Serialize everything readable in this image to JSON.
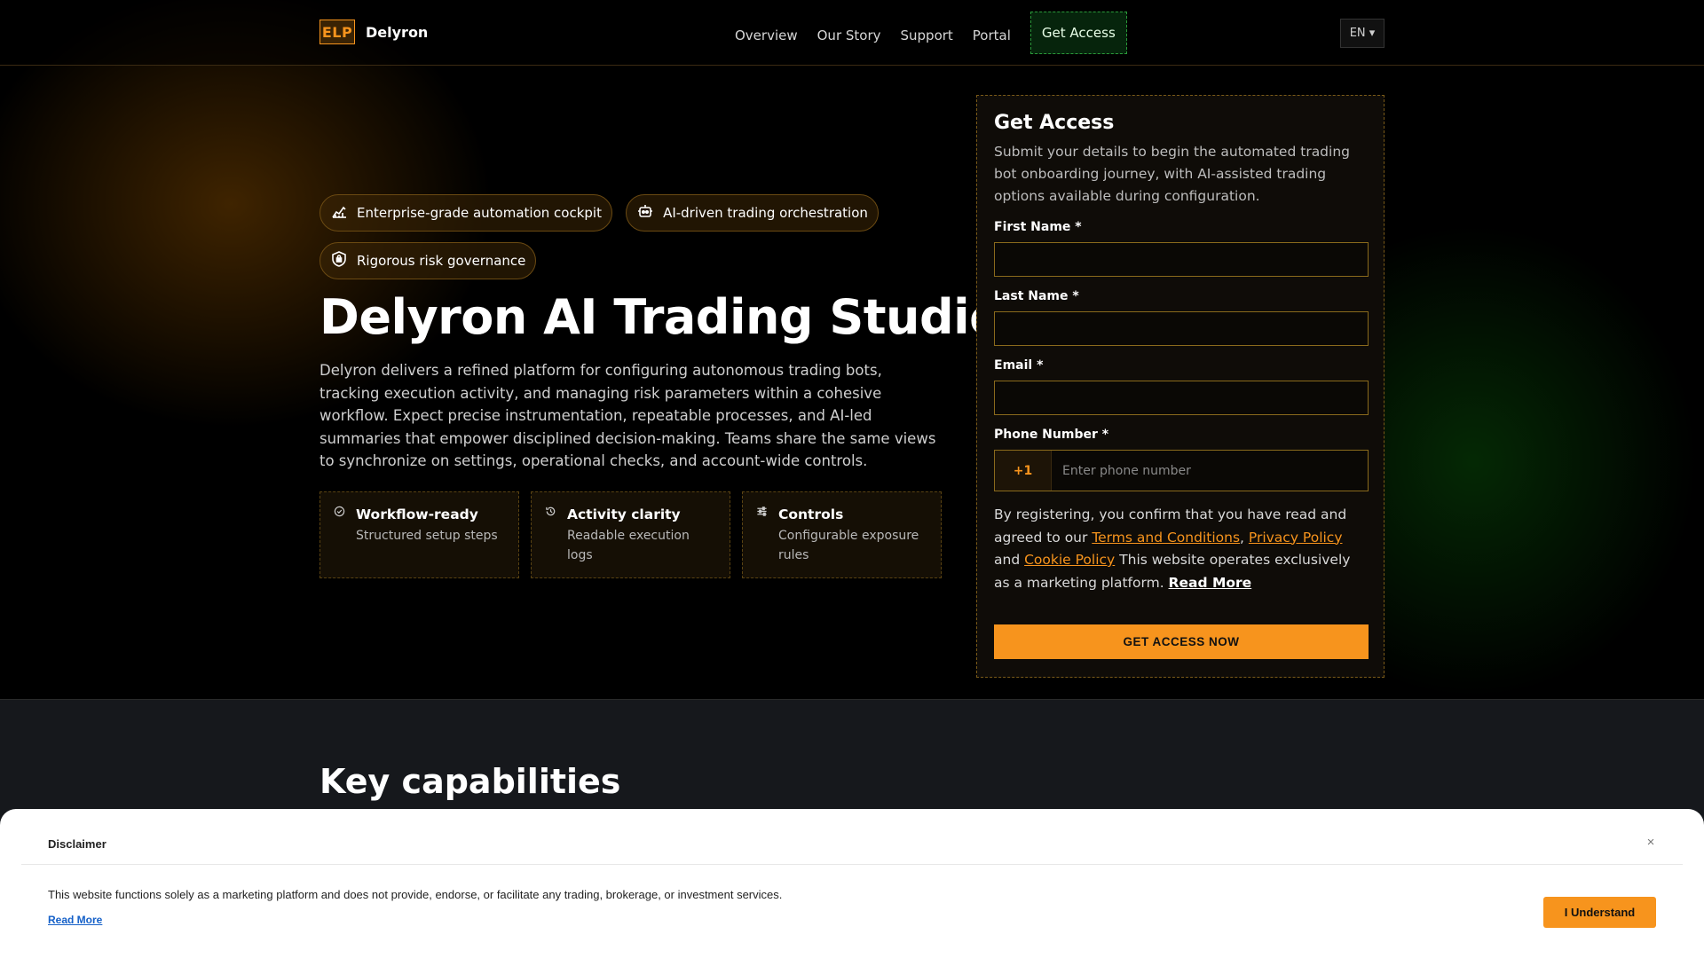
{
  "header": {
    "logo_badge": "ELP",
    "brand": "Delyron",
    "nav": [
      "Overview",
      "Our Story",
      "Support",
      "Portal"
    ],
    "cta": "Get Access",
    "lang": "EN ▾"
  },
  "hero": {
    "pills": [
      {
        "icon": "chart-icon",
        "label": "Enterprise-grade automation cockpit"
      },
      {
        "icon": "robot-icon",
        "label": "AI-driven trading orchestration"
      },
      {
        "icon": "shield-icon",
        "label": "Rigorous risk governance"
      }
    ],
    "title": "Delyron AI Trading Studio",
    "description": "Delyron delivers a refined platform for configuring autonomous trading bots, tracking execution activity, and managing risk parameters within a cohesive workflow. Expect precise instrumentation, repeatable processes, and AI-led summaries that empower disciplined decision-making. Teams share the same views to synchronize on settings, operational checks, and account-wide controls.",
    "features": [
      {
        "icon": "check-circle-icon",
        "title": "Workflow-ready",
        "sub": "Structured setup steps"
      },
      {
        "icon": "history-icon",
        "title": "Activity clarity",
        "sub": "Readable execution logs"
      },
      {
        "icon": "sliders-icon",
        "title": "Controls",
        "sub": "Configurable exposure rules"
      }
    ]
  },
  "form": {
    "title": "Get Access",
    "intro": "Submit your details to begin the automated trading bot onboarding journey, with AI-assisted trading options available during configuration.",
    "first_name_label": "First Name *",
    "last_name_label": "Last Name *",
    "email_label": "Email *",
    "phone_label": "Phone Number *",
    "phone_code": "+1",
    "phone_placeholder": "Enter phone number",
    "consent_prefix": "By registering, you confirm that you have read and agreed to our ",
    "terms": "Terms and Conditions",
    "sep1": ", ",
    "privacy": "Privacy Policy",
    "sep2": " and ",
    "cookie": "Cookie Policy",
    "consent_suffix": " This website operates exclusively as a marketing platform. ",
    "read_more": "Read More",
    "submit": "GET ACCESS NOW"
  },
  "section2": {
    "title": "Key capabilities"
  },
  "disclaimer": {
    "title": "Disclaimer",
    "close": "×",
    "text": "This website functions solely as a marketing platform and does not provide, endorse, or facilitate any trading, brokerage, or investment services.",
    "read_more": "Read More",
    "button": "I Understand"
  },
  "colors": {
    "accent": "#f7941d",
    "green_cta": "#06240c",
    "background": "#000000"
  }
}
